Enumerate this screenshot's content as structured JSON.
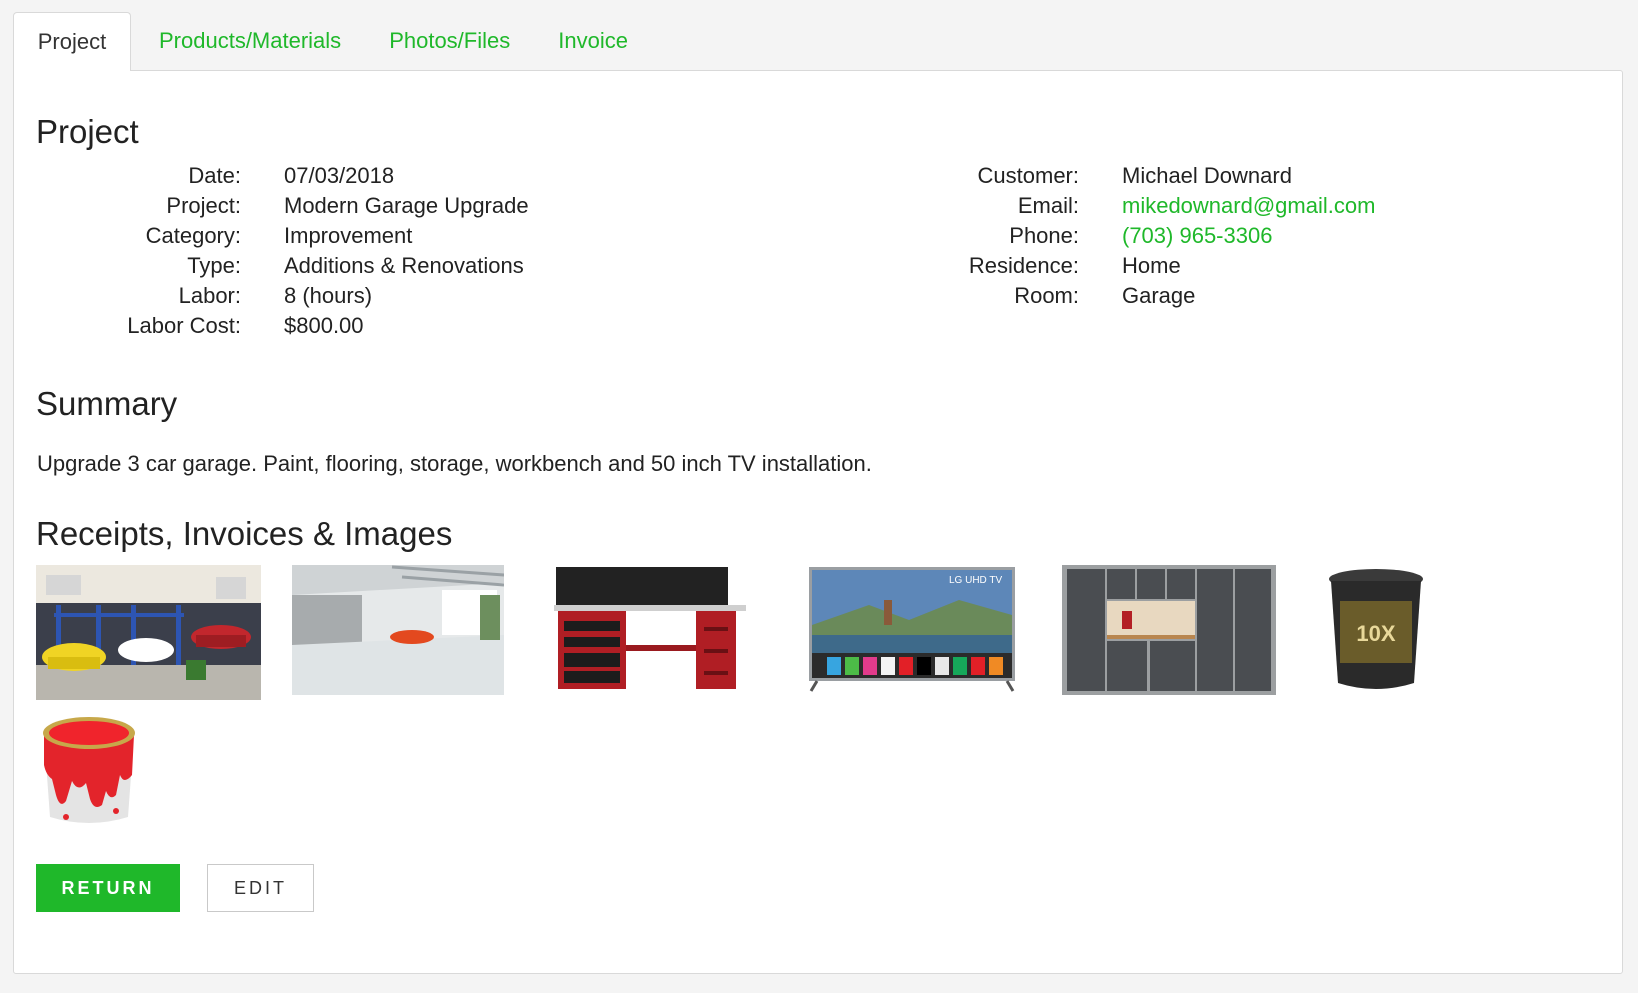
{
  "tabs": [
    {
      "label": "Project"
    },
    {
      "label": "Products/Materials"
    },
    {
      "label": "Photos/Files"
    },
    {
      "label": "Invoice"
    }
  ],
  "project": {
    "heading": "Project",
    "left_fields": [
      {
        "label": "Date:",
        "value": "07/03/2018"
      },
      {
        "label": "Project:",
        "value": "Modern Garage Upgrade"
      },
      {
        "label": "Category:",
        "value": "Improvement"
      },
      {
        "label": "Type:",
        "value": "Additions & Renovations"
      },
      {
        "label": "Labor:",
        "value": "8 (hours)"
      },
      {
        "label": "Labor Cost:",
        "value": "$800.00"
      }
    ],
    "right_fields": [
      {
        "label": "Customer:",
        "value": "Michael Downard"
      },
      {
        "label": "Email:",
        "value": "mikedownard@gmail.com"
      },
      {
        "label": "Phone:",
        "value": "(703) 965-3306"
      },
      {
        "label": "Residence:",
        "value": "Home"
      },
      {
        "label": "Room:",
        "value": "Garage"
      }
    ]
  },
  "summary": {
    "heading": "Summary",
    "text": "Upgrade 3 car garage. Paint, flooring, storage, workbench and 50 inch TV installation."
  },
  "attachments": {
    "heading": "Receipts, Invoices & Images",
    "tv_brand_text": "LG UHD TV",
    "bucket_label_text": "10X"
  },
  "actions": {
    "return_label": "RETURN",
    "edit_label": "EDIT"
  },
  "colors": {
    "accent": "#1fb82a",
    "background": "#f4f4f4"
  }
}
